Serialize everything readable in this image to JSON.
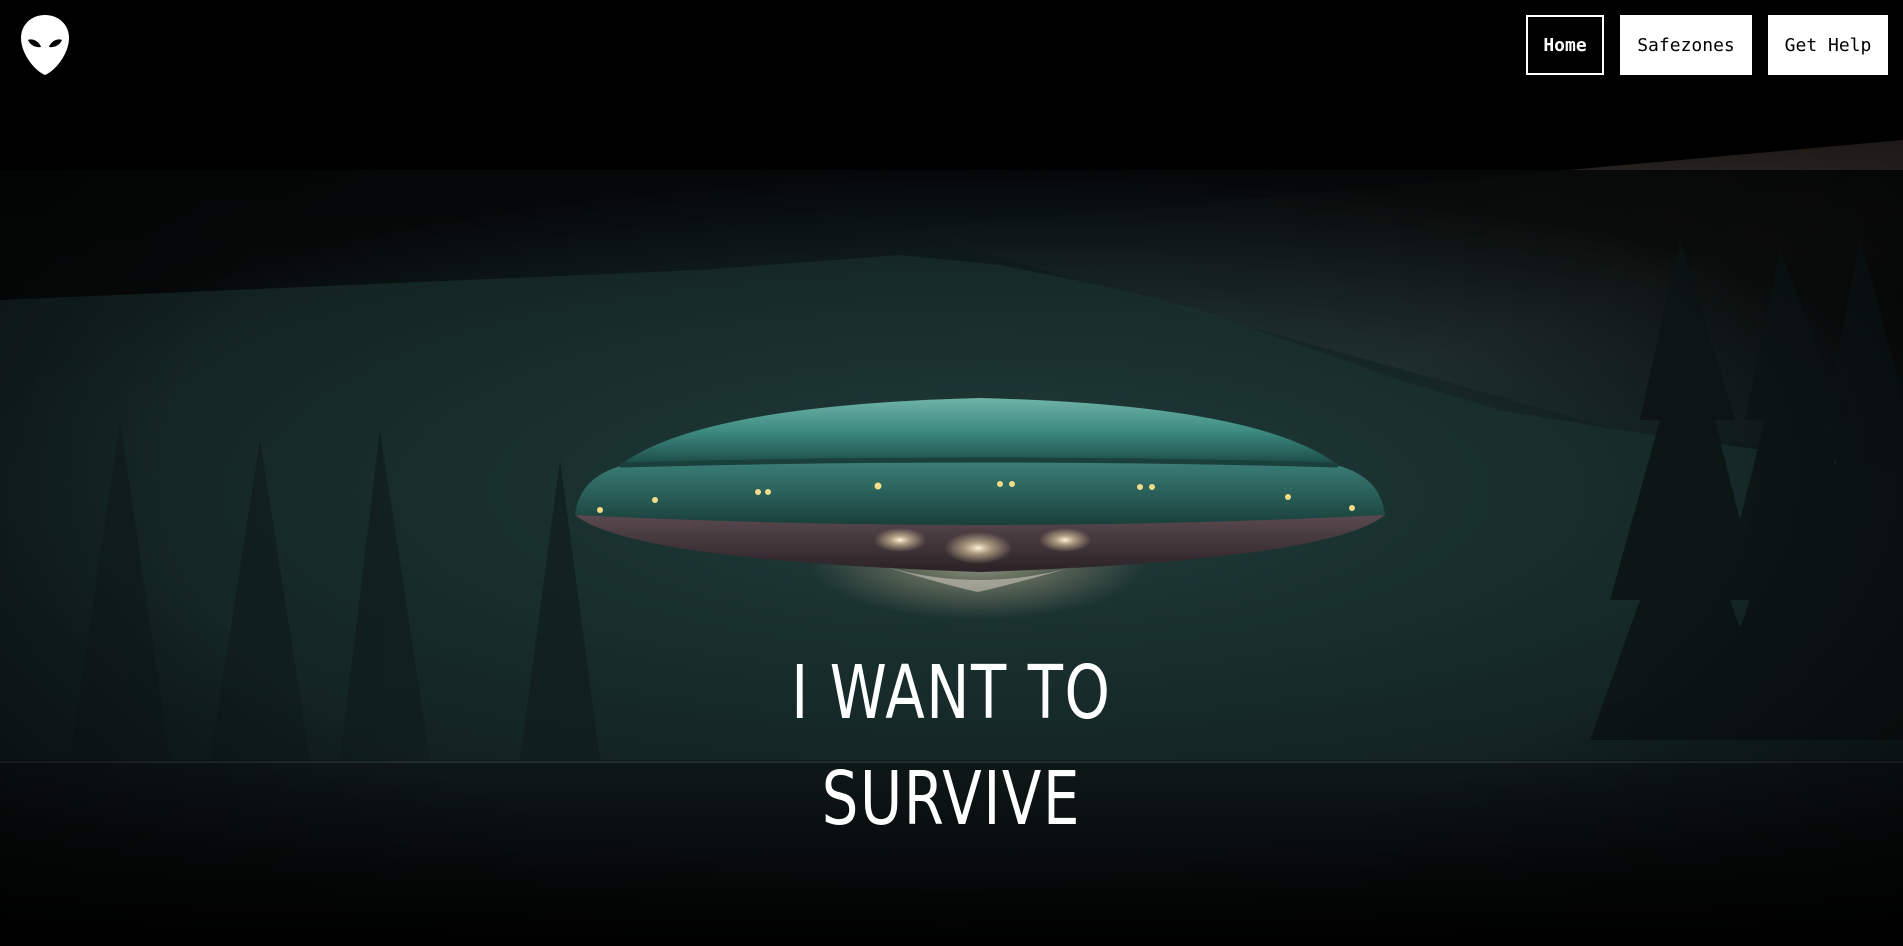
{
  "nav": {
    "logo_icon": "alien-head-icon",
    "links": [
      {
        "label": "Home",
        "active": true
      },
      {
        "label": "Safezones",
        "active": false
      },
      {
        "label": "Get Help",
        "active": false
      }
    ]
  },
  "hero": {
    "headline_line1": "I WANT TO",
    "headline_line2": "SURVIVE",
    "background": "ufo-over-forest-lake-night",
    "colors": {
      "background": "#000000",
      "text": "#ffffff",
      "ufo_hull": "#3f8c84",
      "forest": "#16302f"
    }
  }
}
